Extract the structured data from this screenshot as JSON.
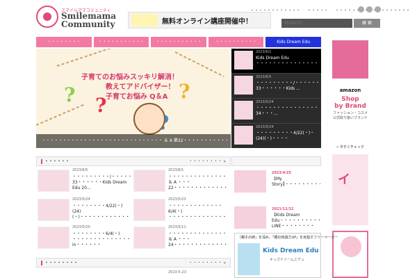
{
  "header": {
    "logo_tagline": "スマイルママコミュニティ",
    "logo_name_line1": "Smilemama",
    "logo_name_line2": "Community",
    "banner_text": "無料オンライン講座開催中！",
    "top_links": [
      "・・・・・・・・・・・・",
      "・・・・・",
      "・・・・・・・・・・・・・・・・・・"
    ],
    "search_placeholder": "SEARCH",
    "search_button": "検 索"
  },
  "nav": {
    "items": [
      "・・・・・・・・",
      "・・・・・・・・・・・",
      "・・・・・・・・・・・",
      "・・・・・・・・・・",
      "Kids Dream Edu"
    ]
  },
  "hero": {
    "title_line1": "子育てのお悩みスッキリ解消！",
    "title_line2": "教えてアドバイザー！",
    "title_line3": "子育てお悩み Q＆A",
    "caption": "・・・・・・・・・・・・・・・・・・・・・・・・・・・・・ ＆ A 第22・・・・・・・・・・・・・・・"
  },
  "slider": {
    "items": [
      {
        "date": "2023/6/1",
        "text": "Kids Dream Edu ・・・・・・・・・・・・・・・・・・・・ ＆ A ..."
      },
      {
        "date": "2023/6/5",
        "text": "・・・・・・・・・/・・・・・・・・・・・33・・・・・・Kids ..."
      },
      {
        "date": "2023/5/24",
        "text": "・・・・・・・・・・・・・・・・・・・・・・・・・・・・・・・34・・・..."
      },
      {
        "date": "2023/5/24",
        "text": "・・・・・・・・・4/22(・)・(24)(・)・・・・"
      }
    ]
  },
  "new_articles": {
    "title": "・・・・・・",
    "more": "・・・・・・・・ »",
    "items": [
      {
        "date": "2023/6/5",
        "text": "・・・・・・・・・/・・・・・・・・・・・33・・・・・・Kids Dream Edu 20..."
      },
      {
        "date": "2023/6/1",
        "text": "・・・・・・・・・・・・・・・・・・・・・・・・・ ＆ A ・・・22・・・・・・・・・・・・・・"
      },
      {
        "date": "2023/5/24",
        "text": "・・・・・・・・4/22(・)(24)(・)・・・・・・・・・・・・・WAKUWAKU..."
      },
      {
        "date": "2023/5/23",
        "text": "・・・・・・・・・・・・・ 6/4(・) ・・・・・・・・・・・・・・・・・・・ in・・・・・"
      },
      {
        "date": "2023/5/20",
        "text": "・・・・・・・・6/4(・) ・・・・・・・・・・・・・・・・・・・・ in・・・・・・"
      },
      {
        "date": "2023/5/11",
        "text": "・・・・・・・・・・・・・・・・・・・・・・・・・ ＆ A ・・・24・・・・・・・・・・・・・・"
      }
    ]
  },
  "second_section": {
    "title": "・・・・・・・・",
    "more": "・・・・・・・・ »",
    "first_date": "2023-5-23"
  },
  "middle": {
    "cards": [
      {
        "date": "2023/4/25",
        "text": "【My Story】・・・・・・・・・・・・・・・・・・・・・・・・"
      },
      {
        "date": "2021/11/12",
        "text": "【Kids Dream Edu・・・・・・・・・・・・・LINE・・・・・・・・2021・・・1・・】"
      }
    ],
    "banner_t1": "［親子の絆」を深め、「親の知識力UP」を目指すフリーペーパー",
    "banner_t2": "Kids Dream Edu",
    "banner_t3": "キッズドリームエデュ"
  },
  "ads": {
    "amazon": "amazon",
    "shop_line1": "Shop",
    "shop_line2": "by Brand",
    "sub_line1": "ファッション・コスメ",
    "sub_line2": "公式取り扱いブランド",
    "check": "» 今すぐチェック",
    "big": "イ"
  }
}
